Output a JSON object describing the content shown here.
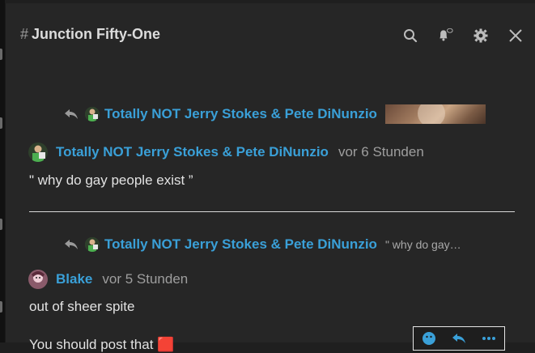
{
  "channel": {
    "hash": "#",
    "name": "Junction Fifty-One"
  },
  "header_icons": [
    "search-icon",
    "bell-icon",
    "gear-icon",
    "close-icon"
  ],
  "messages": [
    {
      "reply_to": {
        "author": "Totally NOT Jerry Stokes & Pete DiNunzio",
        "preview_kind": "image"
      },
      "author": "Totally NOT Jerry Stokes & Pete DiNunzio",
      "timestamp": "vor 6 Stunden",
      "text": "\" why do gay people exist ”"
    },
    {
      "reply_to": {
        "author": "Totally NOT Jerry Stokes & Pete DiNunzio",
        "snippet": "\" why do gay…"
      },
      "author": "Blake",
      "timestamp": "vor 5 Stunden",
      "text": "out of sheer spite",
      "next_text": "You should post that 🟥"
    }
  ],
  "colors": {
    "background": "#262626",
    "author_link": "#3aa0d8",
    "text": "#e2e2e2",
    "muted": "#9e9e9e"
  },
  "hover_toolbar": [
    "emoji-icon",
    "reply-icon",
    "more-icon"
  ]
}
